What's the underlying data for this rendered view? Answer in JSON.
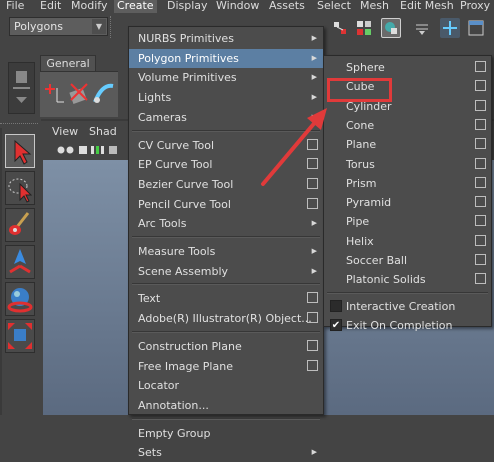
{
  "menubar": {
    "items": [
      "File",
      "Edit",
      "Modify",
      "Create",
      "Display",
      "Window",
      "Assets",
      "Select",
      "Mesh",
      "Edit Mesh",
      "Proxy"
    ],
    "active": "Create"
  },
  "toolbar": {
    "mode_select": "Polygons",
    "icons": [
      "select-by-hierarchy-icon",
      "select-by-component-icon",
      "magnet-snap-icon",
      "layer-icon",
      "plus-icon",
      "window-icon"
    ]
  },
  "shelf": {
    "tab_label": "General"
  },
  "viewport": {
    "menu_label": "View",
    "menu_label_cut": "Shad"
  },
  "create_menu": {
    "items": [
      {
        "label": "NURBS Primitives",
        "type": "submenu"
      },
      {
        "label": "Polygon Primitives",
        "type": "submenu",
        "highlighted": true
      },
      {
        "label": "Volume Primitives",
        "type": "submenu"
      },
      {
        "label": "Lights",
        "type": "submenu"
      },
      {
        "label": "Cameras",
        "type": "submenu"
      },
      {
        "type": "separator"
      },
      {
        "label": "CV Curve Tool",
        "type": "option"
      },
      {
        "label": "EP Curve Tool",
        "type": "option"
      },
      {
        "label": "Bezier Curve Tool",
        "type": "option"
      },
      {
        "label": "Pencil Curve Tool",
        "type": "option"
      },
      {
        "label": "Arc Tools",
        "type": "submenu"
      },
      {
        "type": "separator"
      },
      {
        "label": "Measure Tools",
        "type": "submenu"
      },
      {
        "label": "Scene Assembly",
        "type": "submenu"
      },
      {
        "type": "separator"
      },
      {
        "label": "Text",
        "type": "option"
      },
      {
        "label": "Adobe(R) Illustrator(R) Object...",
        "type": "option"
      },
      {
        "type": "separator"
      },
      {
        "label": "Construction Plane",
        "type": "option"
      },
      {
        "label": "Free Image Plane",
        "type": "option"
      },
      {
        "label": "Locator",
        "type": "plain"
      },
      {
        "label": "Annotation...",
        "type": "plain"
      },
      {
        "type": "separator"
      },
      {
        "label": "Empty Group",
        "type": "plain"
      },
      {
        "label": "Sets",
        "type": "submenu"
      }
    ]
  },
  "polygon_menu": {
    "items": [
      {
        "label": "Sphere",
        "type": "option"
      },
      {
        "label": "Cube",
        "type": "option",
        "annotated": true
      },
      {
        "label": "Cylinder",
        "type": "option"
      },
      {
        "label": "Cone",
        "type": "option"
      },
      {
        "label": "Plane",
        "type": "option"
      },
      {
        "label": "Torus",
        "type": "option"
      },
      {
        "label": "Prism",
        "type": "option"
      },
      {
        "label": "Pyramid",
        "type": "option"
      },
      {
        "label": "Pipe",
        "type": "option"
      },
      {
        "label": "Helix",
        "type": "option"
      },
      {
        "label": "Soccer Ball",
        "type": "option"
      },
      {
        "label": "Platonic Solids",
        "type": "option"
      },
      {
        "type": "separator"
      },
      {
        "label": "Interactive Creation",
        "type": "check",
        "checked": false
      },
      {
        "label": "Exit On Completion",
        "type": "check",
        "checked": true
      }
    ]
  },
  "colors": {
    "menu_bg": "#4c4c4c",
    "highlight": "#5c7fa3",
    "annotation": "#e03a3a",
    "viewport_top": "#7e90a6"
  }
}
